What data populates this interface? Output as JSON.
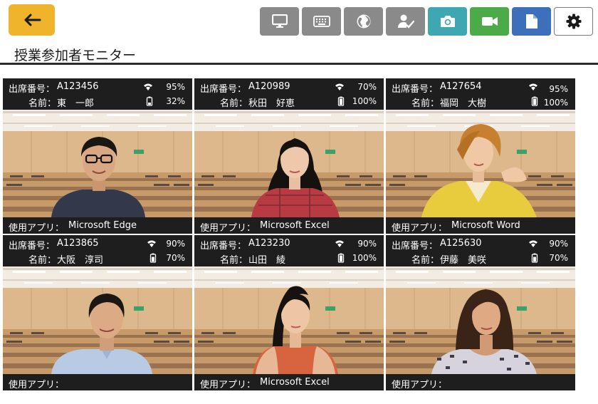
{
  "page": {
    "title": "授業参加者モニター"
  },
  "toolbar": {
    "back_icon": "arrow-left-icon",
    "buttons": [
      {
        "icon": "monitor-icon",
        "color": "#8a8a8a"
      },
      {
        "icon": "keyboard-icon",
        "color": "#8a8a8a"
      },
      {
        "icon": "globe-icon",
        "color": "#8a8a8a"
      },
      {
        "icon": "user-check-icon",
        "color": "#8a8a8a"
      },
      {
        "icon": "camera-icon",
        "color": "#3fa7b1"
      },
      {
        "icon": "video-camera-icon",
        "color": "#4cab48"
      },
      {
        "icon": "document-icon",
        "color": "#3d6fba"
      },
      {
        "icon": "gear-icon",
        "color": "#ffffff"
      }
    ]
  },
  "labels": {
    "id_label": "出席番号：",
    "name_label": "名前：",
    "app_label": "使用アプリ："
  },
  "tiles": [
    {
      "id": "A123456",
      "name": "東　一郎",
      "wifi": "95%",
      "battery": "32%",
      "app": "Microsoft Edge"
    },
    {
      "id": "A120989",
      "name": "秋田　好恵",
      "wifi": "70%",
      "battery": "100%",
      "app": "Microsoft Excel"
    },
    {
      "id": "A127654",
      "name": "福岡　大樹",
      "wifi": "95%",
      "battery": "100%",
      "app": "Microsoft Word"
    },
    {
      "id": "A123865",
      "name": "大阪　淳司",
      "wifi": "90%",
      "battery": "70%",
      "app": ""
    },
    {
      "id": "A123230",
      "name": "山田　綾",
      "wifi": "90%",
      "battery": "100%",
      "app": "Microsoft Excel"
    },
    {
      "id": "A125630",
      "name": "伊藤　美咲",
      "wifi": "90%",
      "battery": "70%",
      "app": ""
    }
  ]
}
